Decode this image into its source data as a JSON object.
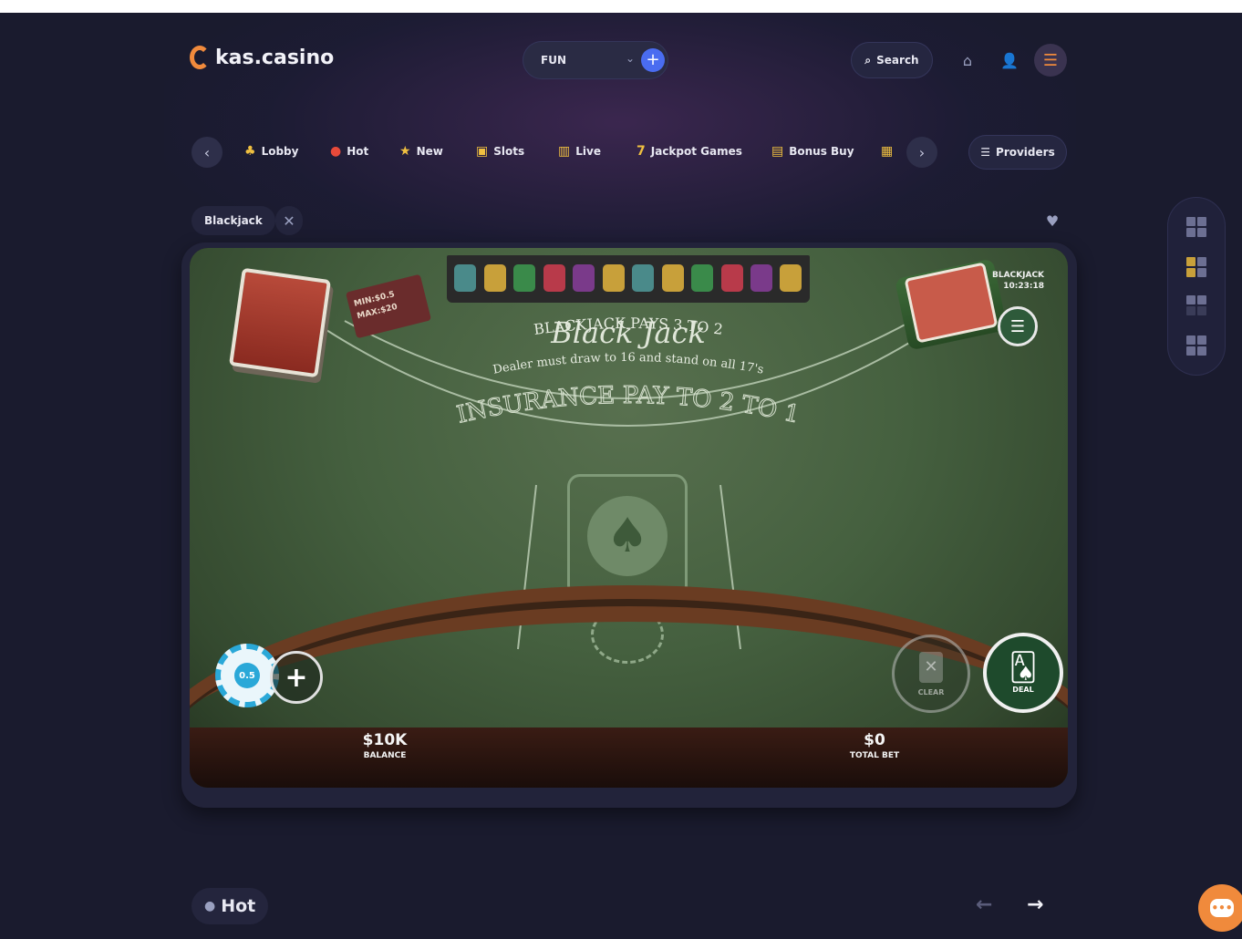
{
  "header": {
    "logo_text": "kas.casino",
    "mode_value": "FUN",
    "search_label": "Search"
  },
  "nav": {
    "categories": [
      {
        "label": "Lobby",
        "icon": "lobby-icon"
      },
      {
        "label": "Hot",
        "icon": "flame-icon"
      },
      {
        "label": "New",
        "icon": "star-icon"
      },
      {
        "label": "Slots",
        "icon": "slots-icon"
      },
      {
        "label": "Live",
        "icon": "live-icon"
      },
      {
        "label": "Jackpot Games",
        "icon": "seven-icon"
      },
      {
        "label": "Bonus Buy",
        "icon": "gift-icon"
      }
    ],
    "providers_label": "Providers"
  },
  "breadcrumb": {
    "label": "Blackjack"
  },
  "game": {
    "title": "Black Jack",
    "line1": "BLACKJACK PAYS 3 TO 2",
    "line2": "Dealer must draw to 16 and stand on all 17's",
    "line3": "INSURANCE PAY TO 2 TO 1",
    "limits_min": "MIN:$0.5",
    "limits_max": "MAX:$20",
    "info_game": "BLACKJACK",
    "info_time": "10:23:18",
    "chip_value": "0.5",
    "clear_label": "CLEAR",
    "deal_label": "DEAL",
    "balance_value": "$10K",
    "balance_label": "BALANCE",
    "total_bet_value": "$0",
    "total_bet_label": "TOTAL BET"
  },
  "section": {
    "hot_label": "Hot"
  },
  "colors": {
    "accent": "#f08a3c",
    "primary": "#4a6cf0",
    "background": "#1a1b2e"
  }
}
